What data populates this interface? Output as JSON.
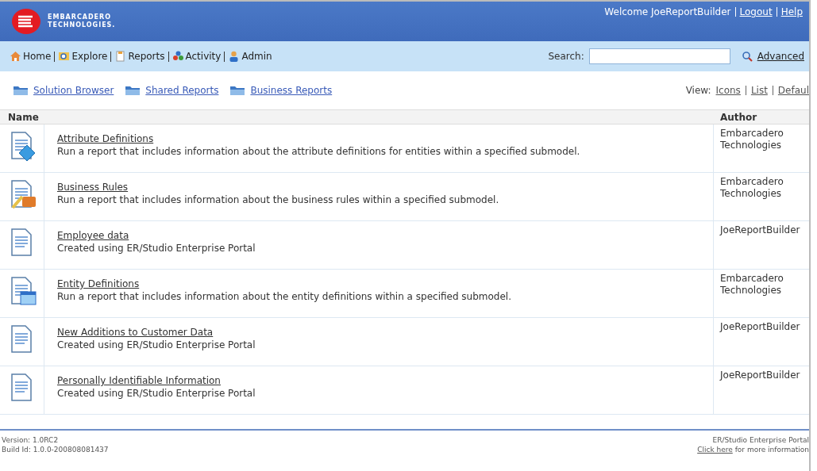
{
  "header": {
    "brand_line_1": "EMBARCADERO",
    "brand_line_2": "TECHNOLOGIES.",
    "welcome": "Welcome JoeReportBuilder",
    "links": [
      "Logout",
      "Help"
    ]
  },
  "nav": {
    "items": [
      {
        "label": "Home",
        "kind": "home"
      },
      {
        "label": "Explore",
        "kind": "explore"
      },
      {
        "label": "Reports",
        "kind": "reports"
      },
      {
        "label": "Activity",
        "kind": "activity"
      },
      {
        "label": "Admin",
        "kind": "admin"
      }
    ],
    "search_label": "Search:",
    "advanced": "Advanced"
  },
  "folders": [
    "Solution Browser",
    "Shared Reports",
    "Business Reports"
  ],
  "view": {
    "label": "View:",
    "options": [
      "Icons",
      "List",
      "Defaul"
    ]
  },
  "table": {
    "columns": [
      "Name",
      "Author"
    ],
    "rows": [
      {
        "kind": "attribute",
        "title": "Attribute Definitions",
        "description": "Run a report that includes information about the attribute definitions for entities within a specified submodel.",
        "author": "Embarcadero Technologies"
      },
      {
        "kind": "rules",
        "title": "Business Rules",
        "description": "Run a report that includes information about the business rules within a specified submodel.",
        "author": "Embarcadero Technologies"
      },
      {
        "kind": "document",
        "title": "Employee data",
        "description": "Created using ER/Studio Enterprise Portal",
        "author": "JoeReportBuilder"
      },
      {
        "kind": "entity",
        "title": "Entity Definitions",
        "description": "Run a report that includes information about the entity definitions within a specified submodel.",
        "author": "Embarcadero Technologies"
      },
      {
        "kind": "document",
        "title": "New Additions to Customer Data",
        "description": "Created using ER/Studio Enterprise Portal",
        "author": "JoeReportBuilder"
      },
      {
        "kind": "document",
        "title": "Personally Identifiable Information",
        "description": "Created using ER/Studio Enterprise Portal",
        "author": "JoeReportBuilder"
      }
    ]
  },
  "footer": {
    "version": "Version: 1.0RC2",
    "build": "Build Id: 1.0.0-200808081437",
    "product": "ER/Studio Enterprise Portal",
    "link": "Click here",
    "link_suffix": "for more information"
  }
}
